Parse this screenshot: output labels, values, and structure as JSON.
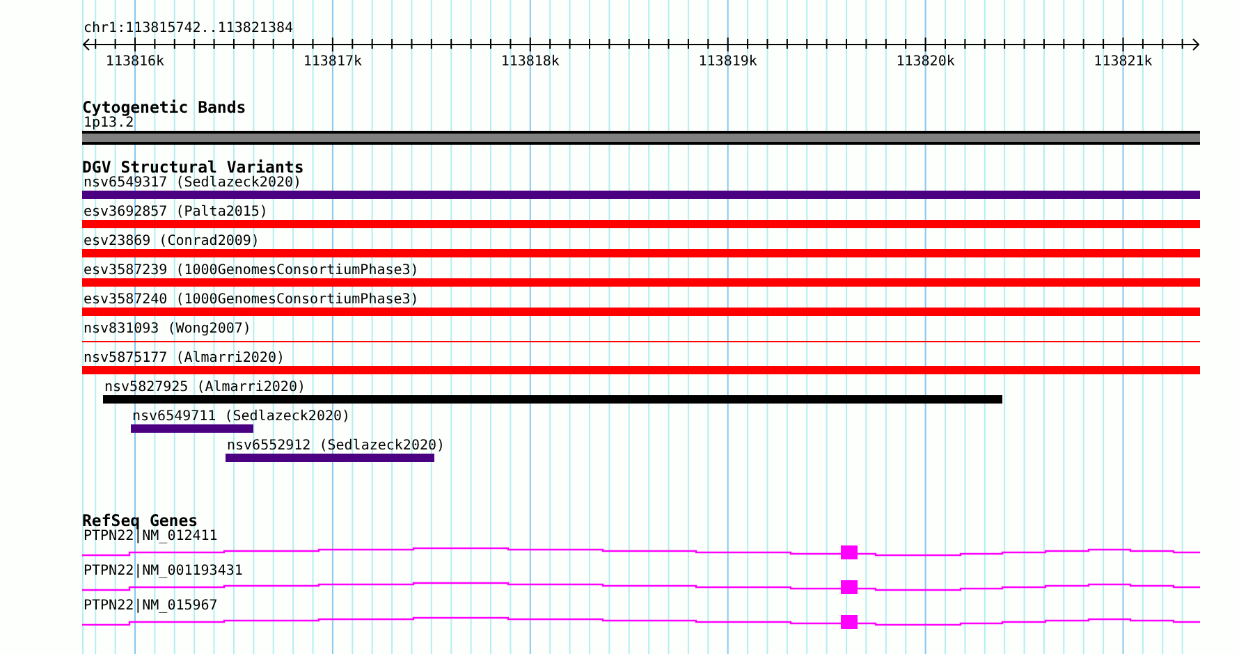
{
  "locus": "chr1:113815742..113821384",
  "ruler": {
    "labels": [
      "113816k",
      "113817k",
      "113818k",
      "113819k",
      "113820k",
      "113821k"
    ]
  },
  "tracks": [
    {
      "kind": "bands",
      "title": "Cytogenetic Bands",
      "features": [
        {
          "label": "1p13.2",
          "kind": "bar",
          "color": "#808080"
        }
      ]
    },
    {
      "kind": "variants",
      "title": "DGV Structural Variants",
      "features": [
        {
          "label": "nsv6549317 (Sedlazeck2020)",
          "kind": "bar",
          "color": "#4b0082"
        },
        {
          "label": "esv3692857 (Palta2015)",
          "kind": "bar",
          "color": "#ff0000"
        },
        {
          "label": "esv23869 (Conrad2009)",
          "kind": "bar",
          "color": "#ff0000"
        },
        {
          "label": "esv3587239 (1000GenomesConsortiumPhase3)",
          "kind": "bar",
          "color": "#ff0000"
        },
        {
          "label": "esv3587240 (1000GenomesConsortiumPhase3)",
          "kind": "bar",
          "color": "#ff0000"
        },
        {
          "label": "nsv831093 (Wong2007)",
          "kind": "line",
          "color": "#ff0000"
        },
        {
          "label": "nsv5875177 (Almarri2020)",
          "kind": "bar",
          "color": "#ff0000"
        },
        {
          "label": "nsv5827925 (Almarri2020)",
          "kind": "bar",
          "color": "#000000"
        },
        {
          "label": "nsv6549711 (Sedlazeck2020)",
          "kind": "bar",
          "color": "#4b0082"
        },
        {
          "label": "nsv6552912 (Sedlazeck2020)",
          "kind": "bar",
          "color": "#4b0082"
        }
      ]
    },
    {
      "kind": "genes",
      "title": "RefSeq Genes",
      "features": [
        {
          "label": "PTPN22|NM_012411",
          "kind": "transcript"
        },
        {
          "label": "PTPN22|NM_001193431",
          "kind": "transcript"
        },
        {
          "label": "PTPN22|NM_015967",
          "kind": "transcript"
        }
      ]
    }
  ]
}
